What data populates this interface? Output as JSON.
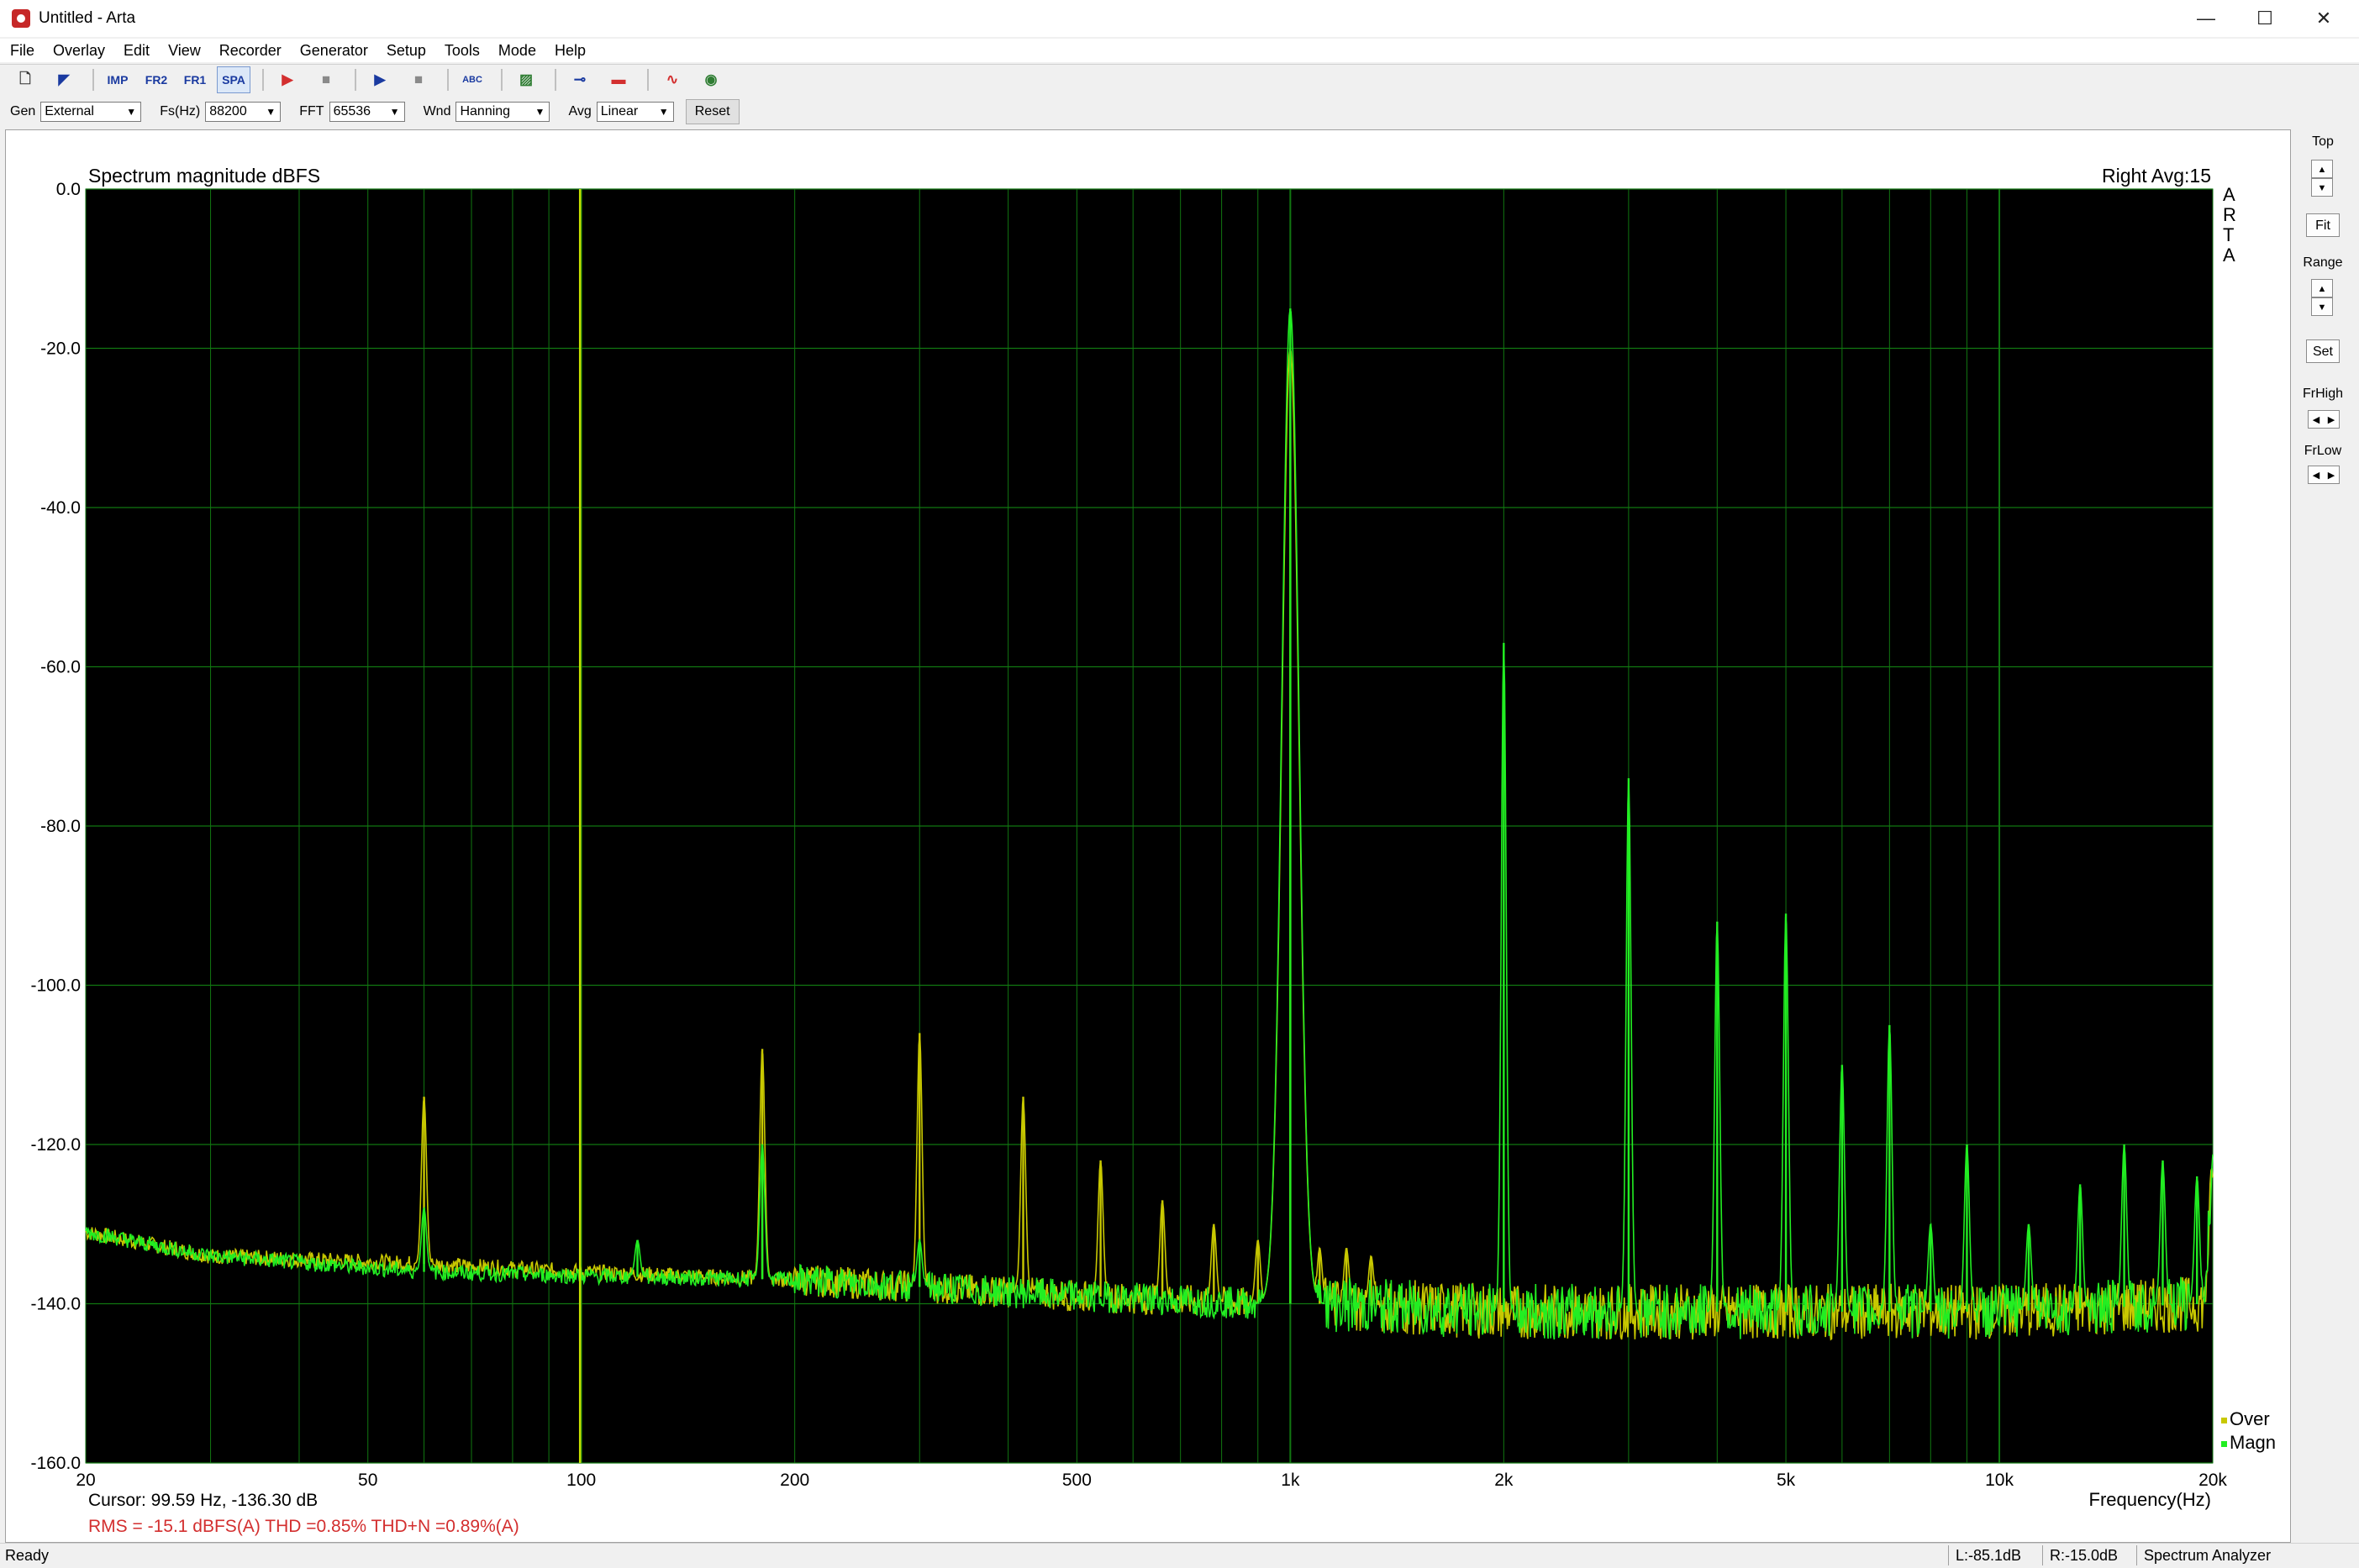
{
  "window": {
    "title": "Untitled - Arta",
    "minimize": "—",
    "maximize": "☐",
    "close": "✕"
  },
  "menu": [
    "File",
    "Overlay",
    "Edit",
    "View",
    "Recorder",
    "Generator",
    "Setup",
    "Tools",
    "Mode",
    "Help"
  ],
  "toolbar": {
    "buttons": [
      {
        "name": "new-icon",
        "glyph": "🗋"
      },
      {
        "name": "open-icon",
        "glyph": "◤"
      },
      {
        "name": "imp-mode-button",
        "glyph": "IMP"
      },
      {
        "name": "fr2-mode-button",
        "glyph": "FR2"
      },
      {
        "name": "fr1-mode-button",
        "glyph": "FR1"
      },
      {
        "name": "spa-mode-button",
        "glyph": "SPA"
      },
      {
        "name": "record-icon",
        "glyph": "▶"
      },
      {
        "name": "stop-icon",
        "glyph": "■"
      },
      {
        "name": "play-icon",
        "glyph": "▶"
      },
      {
        "name": "stop2-icon",
        "glyph": "■"
      },
      {
        "name": "abc-icon",
        "glyph": "ABC"
      },
      {
        "name": "pattern-icon",
        "glyph": "▨"
      },
      {
        "name": "sweep-icon",
        "glyph": "⊸"
      },
      {
        "name": "color-icon",
        "glyph": "▬"
      },
      {
        "name": "wave-icon",
        "glyph": "∿"
      },
      {
        "name": "scope-icon",
        "glyph": "◉"
      }
    ],
    "colors": {
      "blue": "#1a3aa0",
      "red": "#d32f2f",
      "gray": "#8a8a8a",
      "green": "#2e7d32"
    }
  },
  "controls": {
    "gen_label": "Gen",
    "gen_value": "External",
    "fs_label": "Fs(Hz)",
    "fs_value": "88200",
    "fft_label": "FFT",
    "fft_value": "65536",
    "wnd_label": "Wnd",
    "wnd_value": "Hanning",
    "avg_label": "Avg",
    "avg_value": "Linear",
    "reset_label": "Reset"
  },
  "plot": {
    "title": "Spectrum magnitude dBFS",
    "channel_info": "Right  Avg:15",
    "brand_letters": [
      "A",
      "R",
      "T",
      "A"
    ],
    "cursor_text": "Cursor: 99.59 Hz, -136.30 dB",
    "measurement_text": "RMS =  -15.1 dBFS(A)   THD =0.85%   THD+N =0.89%(A)",
    "xlabel": "Frequency(Hz)",
    "legend": [
      {
        "label": "Over",
        "color": "#c8c800"
      },
      {
        "label": "Magn",
        "color": "#22ee22"
      }
    ],
    "cursor_hz": 99.59,
    "background": "#000000",
    "grid_color": "#117711",
    "measurement_color": "#d32f2f"
  },
  "chart_data": {
    "type": "line",
    "xscale": "log",
    "xlim": [
      20,
      20000
    ],
    "ylim": [
      -160,
      0
    ],
    "yticks": [
      {
        "v": 0,
        "label": "0.0"
      },
      {
        "v": -20,
        "label": "-20.0"
      },
      {
        "v": -40,
        "label": "-40.0"
      },
      {
        "v": -60,
        "label": "-60.0"
      },
      {
        "v": -80,
        "label": "-80.0"
      },
      {
        "v": -100,
        "label": "-100.0"
      },
      {
        "v": -120,
        "label": "-120.0"
      },
      {
        "v": -140,
        "label": "-140.0"
      },
      {
        "v": -160,
        "label": "-160.0"
      }
    ],
    "xticks": [
      {
        "v": 20,
        "label": "20"
      },
      {
        "v": 50,
        "label": "50"
      },
      {
        "v": 100,
        "label": "100"
      },
      {
        "v": 200,
        "label": "200"
      },
      {
        "v": 500,
        "label": "500"
      },
      {
        "v": 1000,
        "label": "1k"
      },
      {
        "v": 2000,
        "label": "2k"
      },
      {
        "v": 5000,
        "label": "5k"
      },
      {
        "v": 10000,
        "label": "10k"
      },
      {
        "v": 20000,
        "label": "20k"
      }
    ],
    "grid": true,
    "series": [
      {
        "name": "Magn",
        "color": "#22ee22",
        "baseline": [
          [
            20,
            -131
          ],
          [
            30,
            -134
          ],
          [
            60,
            -136
          ],
          [
            100,
            -136.5
          ],
          [
            200,
            -137
          ],
          [
            500,
            -139
          ],
          [
            900,
            -140
          ],
          [
            1100,
            -140
          ],
          [
            2000,
            -141
          ],
          [
            5000,
            -141
          ],
          [
            10000,
            -141
          ],
          [
            19500,
            -140
          ],
          [
            20000,
            -120
          ]
        ],
        "peaks": [
          [
            60,
            -128
          ],
          [
            120,
            -132
          ],
          [
            180,
            -120
          ],
          [
            300,
            -132
          ],
          [
            1000,
            -15
          ],
          [
            2000,
            -57
          ],
          [
            3000,
            -74
          ],
          [
            4000,
            -92
          ],
          [
            5000,
            -91
          ],
          [
            6000,
            -110
          ],
          [
            7000,
            -105
          ],
          [
            8000,
            -130
          ],
          [
            9000,
            -120
          ],
          [
            11000,
            -130
          ],
          [
            13000,
            -125
          ],
          [
            15000,
            -120
          ],
          [
            17000,
            -122
          ],
          [
            19000,
            -124
          ]
        ]
      },
      {
        "name": "Over",
        "color": "#c8c800",
        "baseline": [
          [
            20,
            -131
          ],
          [
            30,
            -134
          ],
          [
            60,
            -135
          ],
          [
            100,
            -136
          ],
          [
            200,
            -137
          ],
          [
            500,
            -139
          ],
          [
            900,
            -140
          ],
          [
            1100,
            -140
          ],
          [
            2000,
            -141
          ],
          [
            5000,
            -141
          ],
          [
            10000,
            -141
          ],
          [
            19500,
            -140
          ],
          [
            20000,
            -122
          ]
        ],
        "peaks": [
          [
            60,
            -114
          ],
          [
            180,
            -108
          ],
          [
            300,
            -106
          ],
          [
            420,
            -114
          ],
          [
            540,
            -122
          ],
          [
            660,
            -127
          ],
          [
            780,
            -130
          ],
          [
            900,
            -132
          ],
          [
            1000,
            -20
          ],
          [
            1100,
            -133
          ],
          [
            1200,
            -133
          ],
          [
            1300,
            -134
          ]
        ]
      }
    ]
  },
  "right_panel": {
    "top_label": "Top",
    "fit_label": "Fit",
    "range_label": "Range",
    "set_label": "Set",
    "frhigh_label": "FrHigh",
    "frlow_label": "FrLow"
  },
  "status": {
    "ready": "Ready",
    "left_level": "L:-85.1dB",
    "right_level": "R:-15.0dB",
    "mode": "Spectrum Analyzer"
  }
}
